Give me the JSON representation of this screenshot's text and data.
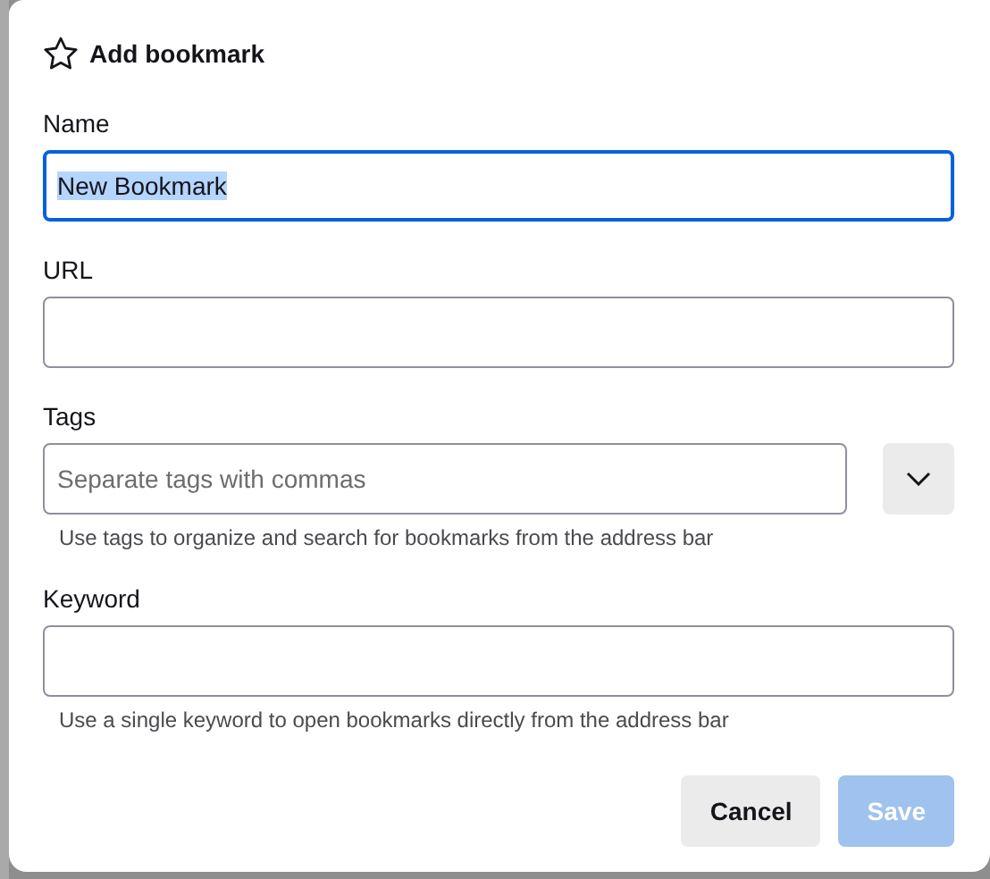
{
  "dialog": {
    "title": "Add bookmark",
    "fields": [
      {
        "kind": "text",
        "label": "Name",
        "value": "New Bookmark",
        "focused": true,
        "value_selected": true
      },
      {
        "kind": "text",
        "label": "URL",
        "focused": false
      },
      {
        "kind": "tags",
        "label": "Tags",
        "placeholder": "Separate tags with commas",
        "focused": false,
        "hint": "Use tags to organize and search for bookmarks from the address bar"
      },
      {
        "kind": "text",
        "label": "Keyword",
        "focused": false,
        "hint": "Use a single keyword to open bookmarks directly from the address bar"
      }
    ],
    "buttons": [
      {
        "label": "Cancel",
        "kind": "secondary",
        "disabled": false
      },
      {
        "label": "Save",
        "kind": "primary",
        "disabled": true
      }
    ]
  }
}
